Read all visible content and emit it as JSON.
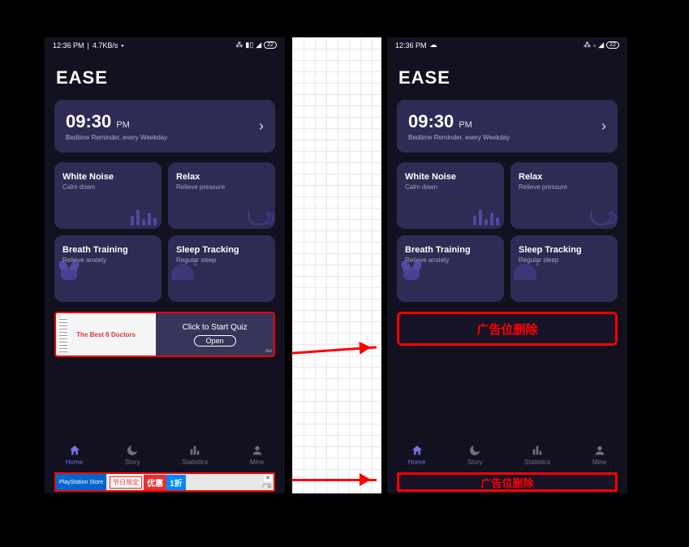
{
  "status": {
    "time_left": "12:36 PM",
    "speed": "4.7KB/s",
    "time_right": "12:36 PM",
    "battery": "22"
  },
  "app": {
    "title": "EASE"
  },
  "reminder": {
    "time": "09:30",
    "ampm": "PM",
    "label": "Bedtime Reminder,",
    "schedule": "every Weekday"
  },
  "tiles": [
    {
      "title": "White Noise",
      "sub": "Calm down"
    },
    {
      "title": "Relax",
      "sub": "Relieve pressure"
    },
    {
      "title": "Breath Training",
      "sub": "Relieve anxiety"
    },
    {
      "title": "Sleep Tracking",
      "sub": "Regular sleep"
    }
  ],
  "ad1": {
    "img_text": "The Best 6 Doctors",
    "text": "Click to Start Quiz",
    "button": "Open",
    "tag": "AD"
  },
  "ad2": {
    "ps": "PlayStation Store",
    "tag_cn": "节日限定",
    "text1": "优惠",
    "text2": "1折",
    "ad_label": "广告"
  },
  "nav": [
    {
      "label": "Home"
    },
    {
      "label": "Story"
    },
    {
      "label": "Statistics"
    },
    {
      "label": "Mine"
    }
  ],
  "removed": "广告位删除"
}
